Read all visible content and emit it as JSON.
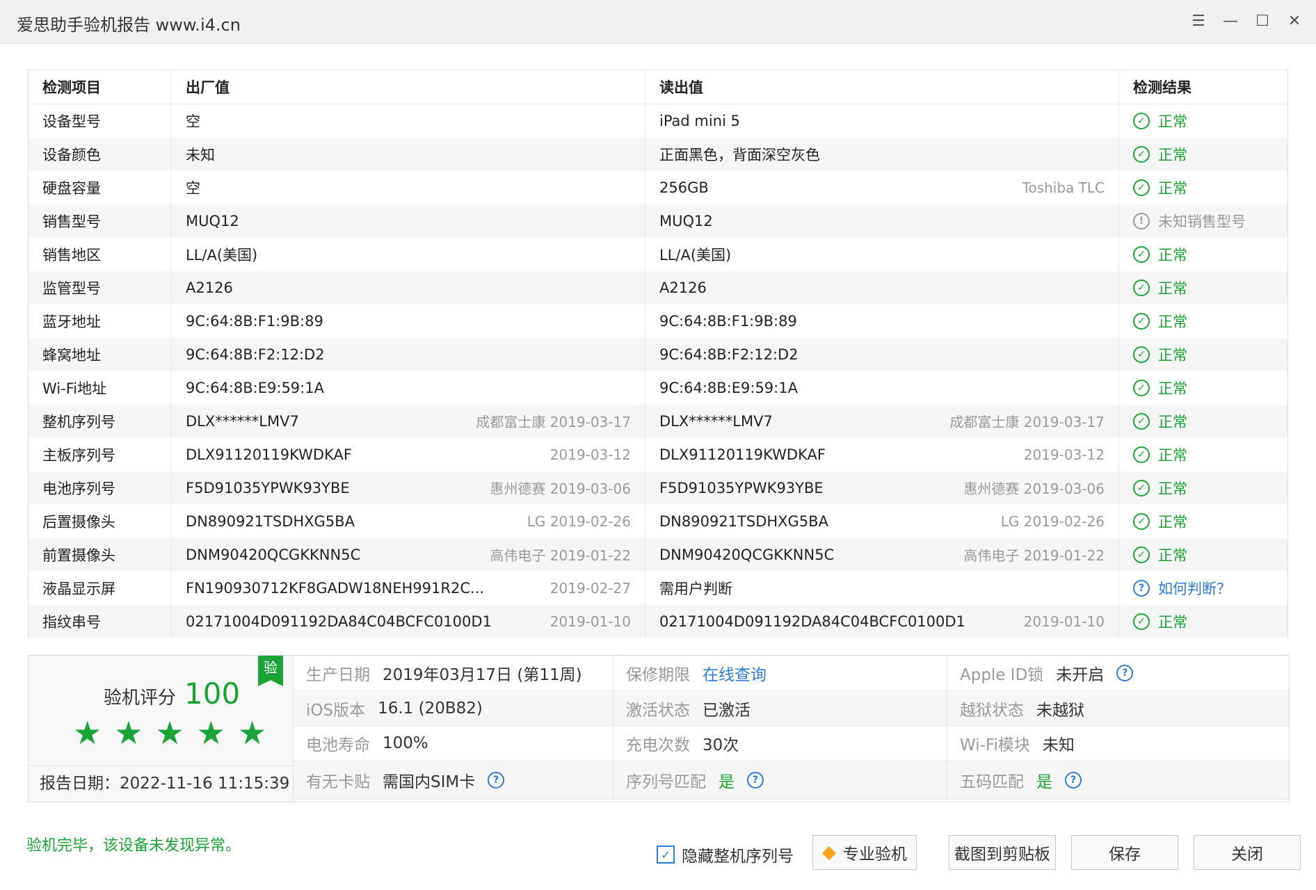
{
  "window": {
    "title": "爱思助手验机报告 www.i4.cn",
    "controls": {
      "menu": "☰",
      "minimize": "—",
      "maximize": "☐",
      "close": "✕"
    }
  },
  "table": {
    "headers": {
      "item": "检测项目",
      "factory": "出厂值",
      "read": "读出值",
      "result": "检测结果"
    },
    "rows": [
      {
        "item": "设备型号",
        "factory": "空",
        "factory_note": "",
        "read": "iPad mini 5",
        "read_note": "",
        "result": "正常",
        "status": "ok"
      },
      {
        "item": "设备颜色",
        "factory": "未知",
        "factory_note": "",
        "read": "正面黑色，背面深空灰色",
        "read_note": "",
        "result": "正常",
        "status": "ok"
      },
      {
        "item": "硬盘容量",
        "factory": "空",
        "factory_note": "",
        "read": "256GB",
        "read_note": "Toshiba TLC",
        "result": "正常",
        "status": "ok"
      },
      {
        "item": "销售型号",
        "factory": "MUQ12",
        "factory_note": "",
        "read": "MUQ12",
        "read_note": "",
        "result": "未知销售型号",
        "status": "warn"
      },
      {
        "item": "销售地区",
        "factory": "LL/A(美国)",
        "factory_note": "",
        "read": "LL/A(美国)",
        "read_note": "",
        "result": "正常",
        "status": "ok"
      },
      {
        "item": "监管型号",
        "factory": "A2126",
        "factory_note": "",
        "read": "A2126",
        "read_note": "",
        "result": "正常",
        "status": "ok"
      },
      {
        "item": "蓝牙地址",
        "factory": "9C:64:8B:F1:9B:89",
        "factory_note": "",
        "read": "9C:64:8B:F1:9B:89",
        "read_note": "",
        "result": "正常",
        "status": "ok"
      },
      {
        "item": "蜂窝地址",
        "factory": "9C:64:8B:F2:12:D2",
        "factory_note": "",
        "read": "9C:64:8B:F2:12:D2",
        "read_note": "",
        "result": "正常",
        "status": "ok"
      },
      {
        "item": "Wi-Fi地址",
        "factory": "9C:64:8B:E9:59:1A",
        "factory_note": "",
        "read": "9C:64:8B:E9:59:1A",
        "read_note": "",
        "result": "正常",
        "status": "ok"
      },
      {
        "item": "整机序列号",
        "factory": "DLX******LMV7",
        "factory_note": "成都富士康 2019-03-17",
        "read": "DLX******LMV7",
        "read_note": "成都富士康 2019-03-17",
        "result": "正常",
        "status": "ok"
      },
      {
        "item": "主板序列号",
        "factory": "DLX91120119KWDKAF",
        "factory_note": "2019-03-12",
        "read": "DLX91120119KWDKAF",
        "read_note": "2019-03-12",
        "result": "正常",
        "status": "ok"
      },
      {
        "item": "电池序列号",
        "factory": "F5D91035YPWK93YBE",
        "factory_note": "惠州德赛 2019-03-06",
        "read": "F5D91035YPWK93YBE",
        "read_note": "惠州德赛 2019-03-06",
        "result": "正常",
        "status": "ok"
      },
      {
        "item": "后置摄像头",
        "factory": "DN890921TSDHXG5BA",
        "factory_note": "LG 2019-02-26",
        "read": "DN890921TSDHXG5BA",
        "read_note": "LG 2019-02-26",
        "result": "正常",
        "status": "ok"
      },
      {
        "item": "前置摄像头",
        "factory": "DNM90420QCGKKNN5C",
        "factory_note": "高伟电子 2019-01-22",
        "read": "DNM90420QCGKKNN5C",
        "read_note": "高伟电子 2019-01-22",
        "result": "正常",
        "status": "ok"
      },
      {
        "item": "液晶显示屏",
        "factory": "FN190930712KF8GADW18NEH991R2C...",
        "factory_note": "2019-02-27",
        "read": "需用户判断",
        "read_note": "",
        "result": "如何判断？",
        "status": "help"
      },
      {
        "item": "指纹串号",
        "factory": "02171004D091192DA84C04BCFC0100D1",
        "factory_note": "2019-01-10",
        "read": "02171004D091192DA84C04BCFC0100D1",
        "read_note": "2019-01-10",
        "result": "正常",
        "status": "ok"
      }
    ]
  },
  "summary": {
    "score_label": "验机评分",
    "score": "100",
    "stars": 5,
    "badge": "验",
    "report_date": "报告日期：2022-11-16 11:15:39",
    "info": [
      {
        "label": "生产日期",
        "value": "2019年03月17日 (第11周)",
        "style": "normal",
        "help": false
      },
      {
        "label": "保修期限",
        "value": "在线查询",
        "style": "link",
        "help": false
      },
      {
        "label": "Apple ID锁",
        "value": "未开启",
        "style": "normal",
        "help": true
      },
      {
        "label": "iOS版本",
        "value": "16.1 (20B82)",
        "style": "normal",
        "help": false
      },
      {
        "label": "激活状态",
        "value": "已激活",
        "style": "normal",
        "help": false
      },
      {
        "label": "越狱状态",
        "value": "未越狱",
        "style": "normal",
        "help": false
      },
      {
        "label": "电池寿命",
        "value": "100%",
        "style": "normal",
        "help": false
      },
      {
        "label": "充电次数",
        "value": "30次",
        "style": "normal",
        "help": false
      },
      {
        "label": "Wi-Fi模块",
        "value": "未知",
        "style": "normal",
        "help": false
      },
      {
        "label": "有无卡贴",
        "value": "需国内SIM卡",
        "style": "normal",
        "help": true
      },
      {
        "label": "序列号匹配",
        "value": "是",
        "style": "green",
        "help": true
      },
      {
        "label": "五码匹配",
        "value": "是",
        "style": "green",
        "help": true
      }
    ]
  },
  "footer": {
    "status": "验机完毕，该设备未发现异常。",
    "hide_serial_label": "隐藏整机序列号",
    "hide_serial_checked": true,
    "pro_button": "专业验机",
    "screenshot_button": "截图到剪贴板",
    "save_button": "保存",
    "close_button": "关闭"
  },
  "colors": {
    "ok": "#1aa336",
    "link": "#2f7ad6",
    "muted": "#9a9a9a",
    "pro_icon": "#f2a51a"
  }
}
